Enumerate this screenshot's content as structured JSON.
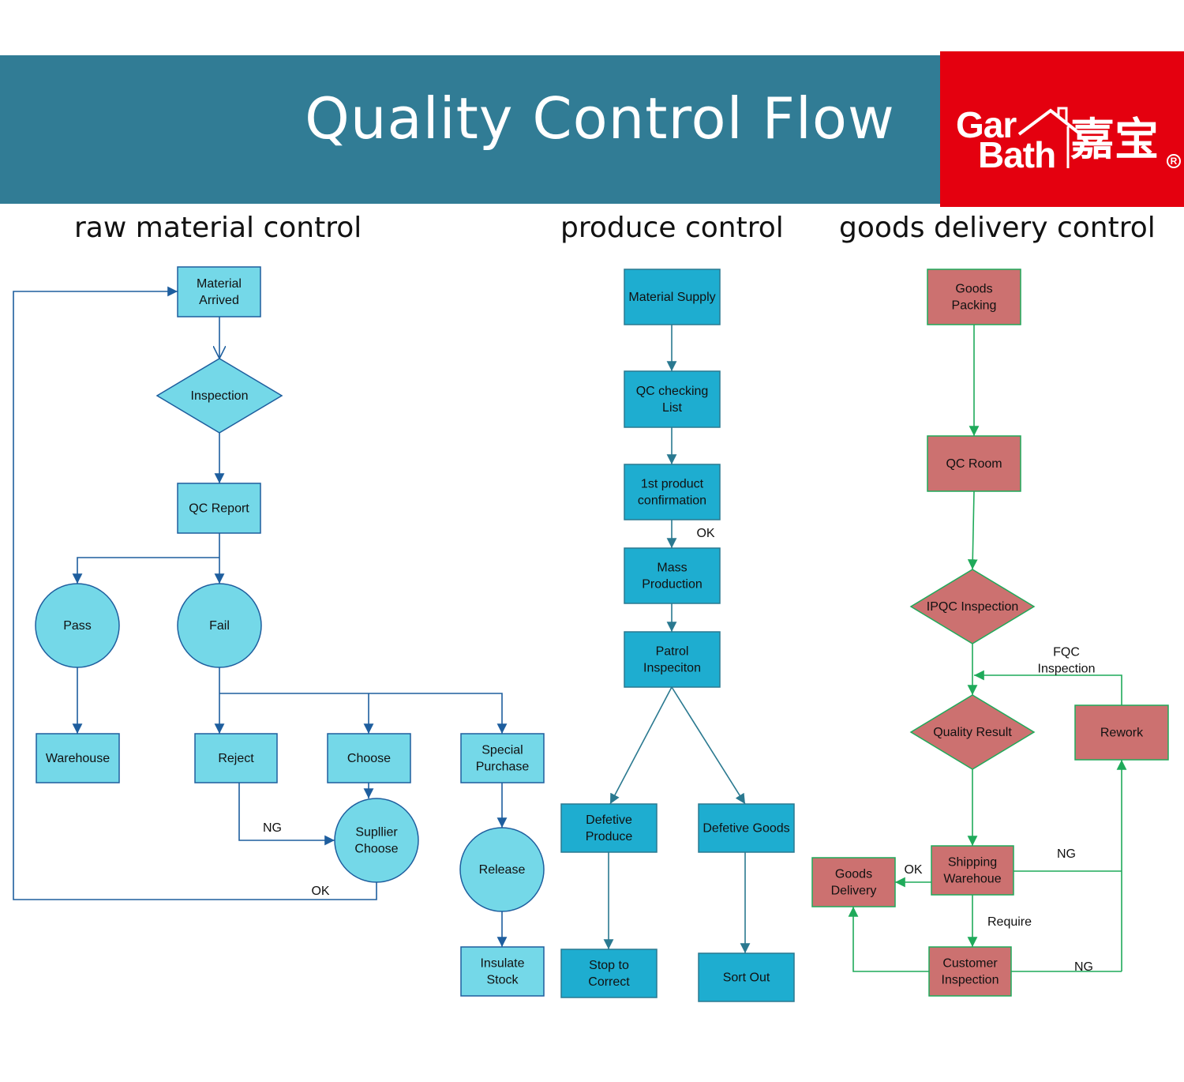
{
  "header": {
    "title": "Quality Control Flow",
    "logo": {
      "line1": "Gar",
      "line2": "Bath",
      "chinese": "嘉宝",
      "registered": "R"
    }
  },
  "colors": {
    "banner": "#317c95",
    "logo_bg": "#e4000f",
    "raw_fill": "#74d8e8",
    "raw_stroke": "#1e5e9e",
    "produce_fill": "#1eadd0",
    "produce_stroke": "#2a7990",
    "delivery_fill": "#cc7170",
    "delivery_stroke": "#1faa5a"
  },
  "sections": {
    "raw": {
      "title": "raw material control",
      "nodes": {
        "material_arrived": "Material\nArrived",
        "inspection": "Inspection",
        "qc_report": "QC Report",
        "pass": "Pass",
        "fail": "Fail",
        "warehouse": "Warehouse",
        "reject": "Reject",
        "choose": "Choose",
        "special_purchase": "Special\nPurchase",
        "supplier_choose": "Supllier\nChoose",
        "release": "Release",
        "insulate_stock": "Insulate\nStock"
      },
      "edge_labels": {
        "ng": "NG",
        "ok": "OK"
      }
    },
    "produce": {
      "title": "produce control",
      "nodes": {
        "material_supply": "Material  Supply",
        "qc_checking_list": "QC checking\nList",
        "first_product": "1st product\nconfirmation",
        "mass_production": "Mass\nProduction",
        "patrol_inspection": "Patrol\nInspeciton",
        "defective_produce": "Defetive\nProduce",
        "defective_goods": "Defetive Goods",
        "stop_to_correct": "Stop to\nCorrect",
        "sort_out": "Sort Out"
      },
      "edge_labels": {
        "ok": "OK"
      }
    },
    "delivery": {
      "title": "goods delivery control",
      "nodes": {
        "goods_packing": "Goods\nPacking",
        "qc_room": "QC Room",
        "ipqc_inspection": "IPQC Inspection",
        "quality_result": "Quality  Result",
        "rework": "Rework",
        "shipping_warehouse": "Shipping\nWarehoue",
        "goods_delivery": "Goods\nDelivery",
        "customer_inspection": "Customer\nInspection"
      },
      "edge_labels": {
        "fqc": "FQC\nInspection",
        "ok": "OK",
        "ng1": "NG",
        "require": "Require",
        "ng2": "NG"
      }
    }
  }
}
